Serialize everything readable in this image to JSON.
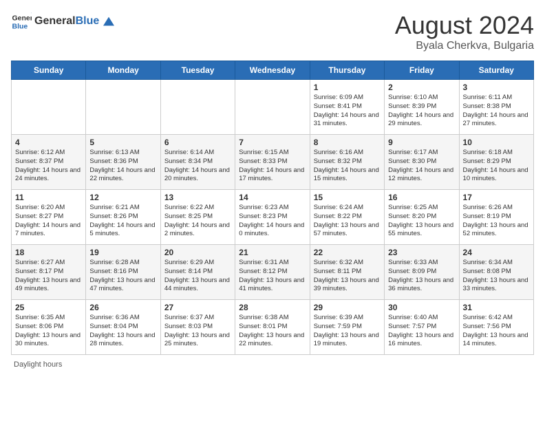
{
  "header": {
    "logo_general": "General",
    "logo_blue": "Blue",
    "month_year": "August 2024",
    "location": "Byala Cherkva, Bulgaria"
  },
  "days_of_week": [
    "Sunday",
    "Monday",
    "Tuesday",
    "Wednesday",
    "Thursday",
    "Friday",
    "Saturday"
  ],
  "weeks": [
    [
      {
        "day": "",
        "content": ""
      },
      {
        "day": "",
        "content": ""
      },
      {
        "day": "",
        "content": ""
      },
      {
        "day": "",
        "content": ""
      },
      {
        "day": "1",
        "content": "Sunrise: 6:09 AM\nSunset: 8:41 PM\nDaylight: 14 hours and 31 minutes."
      },
      {
        "day": "2",
        "content": "Sunrise: 6:10 AM\nSunset: 8:39 PM\nDaylight: 14 hours and 29 minutes."
      },
      {
        "day": "3",
        "content": "Sunrise: 6:11 AM\nSunset: 8:38 PM\nDaylight: 14 hours and 27 minutes."
      }
    ],
    [
      {
        "day": "4",
        "content": "Sunrise: 6:12 AM\nSunset: 8:37 PM\nDaylight: 14 hours and 24 minutes."
      },
      {
        "day": "5",
        "content": "Sunrise: 6:13 AM\nSunset: 8:36 PM\nDaylight: 14 hours and 22 minutes."
      },
      {
        "day": "6",
        "content": "Sunrise: 6:14 AM\nSunset: 8:34 PM\nDaylight: 14 hours and 20 minutes."
      },
      {
        "day": "7",
        "content": "Sunrise: 6:15 AM\nSunset: 8:33 PM\nDaylight: 14 hours and 17 minutes."
      },
      {
        "day": "8",
        "content": "Sunrise: 6:16 AM\nSunset: 8:32 PM\nDaylight: 14 hours and 15 minutes."
      },
      {
        "day": "9",
        "content": "Sunrise: 6:17 AM\nSunset: 8:30 PM\nDaylight: 14 hours and 12 minutes."
      },
      {
        "day": "10",
        "content": "Sunrise: 6:18 AM\nSunset: 8:29 PM\nDaylight: 14 hours and 10 minutes."
      }
    ],
    [
      {
        "day": "11",
        "content": "Sunrise: 6:20 AM\nSunset: 8:27 PM\nDaylight: 14 hours and 7 minutes."
      },
      {
        "day": "12",
        "content": "Sunrise: 6:21 AM\nSunset: 8:26 PM\nDaylight: 14 hours and 5 minutes."
      },
      {
        "day": "13",
        "content": "Sunrise: 6:22 AM\nSunset: 8:25 PM\nDaylight: 14 hours and 2 minutes."
      },
      {
        "day": "14",
        "content": "Sunrise: 6:23 AM\nSunset: 8:23 PM\nDaylight: 14 hours and 0 minutes."
      },
      {
        "day": "15",
        "content": "Sunrise: 6:24 AM\nSunset: 8:22 PM\nDaylight: 13 hours and 57 minutes."
      },
      {
        "day": "16",
        "content": "Sunrise: 6:25 AM\nSunset: 8:20 PM\nDaylight: 13 hours and 55 minutes."
      },
      {
        "day": "17",
        "content": "Sunrise: 6:26 AM\nSunset: 8:19 PM\nDaylight: 13 hours and 52 minutes."
      }
    ],
    [
      {
        "day": "18",
        "content": "Sunrise: 6:27 AM\nSunset: 8:17 PM\nDaylight: 13 hours and 49 minutes."
      },
      {
        "day": "19",
        "content": "Sunrise: 6:28 AM\nSunset: 8:16 PM\nDaylight: 13 hours and 47 minutes."
      },
      {
        "day": "20",
        "content": "Sunrise: 6:29 AM\nSunset: 8:14 PM\nDaylight: 13 hours and 44 minutes."
      },
      {
        "day": "21",
        "content": "Sunrise: 6:31 AM\nSunset: 8:12 PM\nDaylight: 13 hours and 41 minutes."
      },
      {
        "day": "22",
        "content": "Sunrise: 6:32 AM\nSunset: 8:11 PM\nDaylight: 13 hours and 39 minutes."
      },
      {
        "day": "23",
        "content": "Sunrise: 6:33 AM\nSunset: 8:09 PM\nDaylight: 13 hours and 36 minutes."
      },
      {
        "day": "24",
        "content": "Sunrise: 6:34 AM\nSunset: 8:08 PM\nDaylight: 13 hours and 33 minutes."
      }
    ],
    [
      {
        "day": "25",
        "content": "Sunrise: 6:35 AM\nSunset: 8:06 PM\nDaylight: 13 hours and 30 minutes."
      },
      {
        "day": "26",
        "content": "Sunrise: 6:36 AM\nSunset: 8:04 PM\nDaylight: 13 hours and 28 minutes."
      },
      {
        "day": "27",
        "content": "Sunrise: 6:37 AM\nSunset: 8:03 PM\nDaylight: 13 hours and 25 minutes."
      },
      {
        "day": "28",
        "content": "Sunrise: 6:38 AM\nSunset: 8:01 PM\nDaylight: 13 hours and 22 minutes."
      },
      {
        "day": "29",
        "content": "Sunrise: 6:39 AM\nSunset: 7:59 PM\nDaylight: 13 hours and 19 minutes."
      },
      {
        "day": "30",
        "content": "Sunrise: 6:40 AM\nSunset: 7:57 PM\nDaylight: 13 hours and 16 minutes."
      },
      {
        "day": "31",
        "content": "Sunrise: 6:42 AM\nSunset: 7:56 PM\nDaylight: 13 hours and 14 minutes."
      }
    ]
  ],
  "footer": {
    "daylight_hours": "Daylight hours"
  }
}
